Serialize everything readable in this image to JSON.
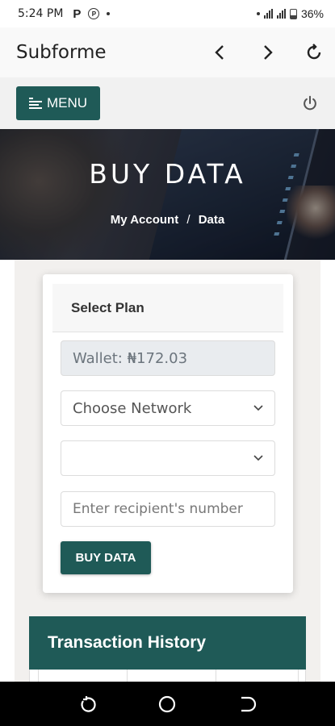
{
  "status_bar": {
    "time": "5:24 PM",
    "left_icons": [
      "p-icon",
      "copyright-icon",
      "dot-icon"
    ],
    "p_label": "P",
    "battery": "36%"
  },
  "browser": {
    "title": "Subforme",
    "icons": [
      "back-icon",
      "forward-icon",
      "reload-icon"
    ]
  },
  "header": {
    "menu_label": "MENU",
    "accent": "#1f5a57"
  },
  "hero": {
    "title": "BUY DATA",
    "breadcrumb": {
      "parent": "My Account",
      "separator": "/",
      "current": "Data"
    }
  },
  "form": {
    "heading": "Select Plan",
    "wallet": "Wallet: ₦172.03",
    "network_select": "Choose Network",
    "plan_select": "",
    "recipient_placeholder": "Enter recipient's number",
    "submit_label": "BUY DATA"
  },
  "history": {
    "title": "Transaction History"
  },
  "nav_bar": {
    "icons": [
      "recents-icon",
      "home-icon",
      "back-icon"
    ]
  }
}
